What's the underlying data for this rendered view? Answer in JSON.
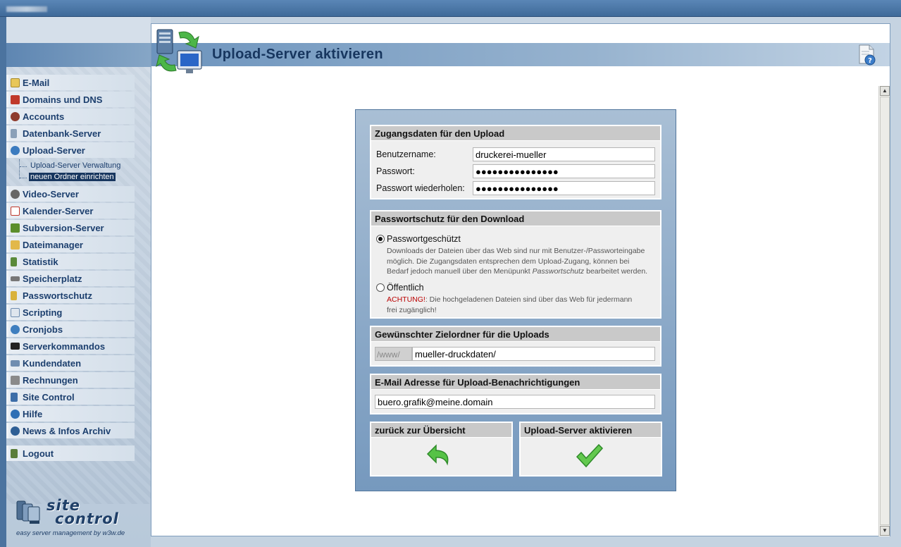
{
  "window": {
    "title": ""
  },
  "sidebar": {
    "items": [
      {
        "label": "E-Mail",
        "icon": "mail-icon",
        "color": "#e8c75a"
      },
      {
        "label": "Domains und DNS",
        "icon": "domains-icon",
        "color": "#c0392b"
      },
      {
        "label": "Accounts",
        "icon": "accounts-icon",
        "color": "#8e3b2d"
      },
      {
        "label": "Datenbank-Server",
        "icon": "database-icon",
        "color": "#8aa0b8"
      },
      {
        "label": "Upload-Server",
        "icon": "upload-server-icon",
        "color": "#3b7bbf"
      }
    ],
    "subitems": [
      {
        "label": "Upload-Server Verwaltung",
        "active": false
      },
      {
        "label": "neuen Ordner einrichten",
        "active": true
      }
    ],
    "items2": [
      {
        "label": "Video-Server",
        "icon": "video-icon",
        "color": "#666"
      },
      {
        "label": "Kalender-Server",
        "icon": "calendar-icon",
        "color": "#c0392b"
      },
      {
        "label": "Subversion-Server",
        "icon": "subversion-icon",
        "color": "#5b8e2c"
      },
      {
        "label": "Dateimanager",
        "icon": "folder-icon",
        "color": "#e2b84a"
      },
      {
        "label": "Statistik",
        "icon": "statistics-icon",
        "color": "#5a8a3a"
      },
      {
        "label": "Speicherplatz",
        "icon": "disk-icon",
        "color": "#777"
      },
      {
        "label": "Passwortschutz",
        "icon": "lock-icon",
        "color": "#d9b23c"
      },
      {
        "label": "Scripting",
        "icon": "script-icon",
        "color": "#6f8db0"
      },
      {
        "label": "Cronjobs",
        "icon": "cronjobs-icon",
        "color": "#3f7fbf"
      },
      {
        "label": "Serverkommandos",
        "icon": "terminal-icon",
        "color": "#222"
      },
      {
        "label": "Kundendaten",
        "icon": "customer-data-icon",
        "color": "#6f8db0"
      },
      {
        "label": "Rechnungen",
        "icon": "invoice-icon",
        "color": "#8a8a8a"
      },
      {
        "label": "Site Control",
        "icon": "site-control-icon",
        "color": "#3d6ea8"
      },
      {
        "label": "Hilfe",
        "icon": "help-icon",
        "color": "#2f6fb5"
      },
      {
        "label": "News & Infos Archiv",
        "icon": "info-icon",
        "color": "#2f5f95"
      }
    ],
    "logout": {
      "label": "Logout",
      "icon": "logout-icon",
      "color": "#5a7d3a"
    },
    "logo": {
      "word1": "site",
      "word2": "control",
      "tagline": "easy server management by w3w.de"
    }
  },
  "header": {
    "title": "Upload-Server aktivieren"
  },
  "form": {
    "access": {
      "heading": "Zugangsdaten für den Upload",
      "username_label": "Benutzername:",
      "username_value": "druckerei-mueller",
      "password_label": "Passwort:",
      "password_value": "●●●●●●●●●●●●●●●",
      "password_repeat_label": "Passwort wiederholen:",
      "password_repeat_value": "●●●●●●●●●●●●●●●"
    },
    "protection": {
      "heading": "Passwortschutz für den Download",
      "option1_label": "Passwortgeschützt",
      "option1_desc_a": "Downloads der Dateien über das Web sind nur mit Benutzer-/Passworteingabe",
      "option1_desc_b": "möglich. Die Zugangsdaten entsprechen dem Upload-Zugang, können bei",
      "option1_desc_c": "Bedarf jedoch manuell über den Menüpunkt",
      "option1_desc_em": "Passwortschutz",
      "option1_desc_d": "bearbeitet werden.",
      "option2_label": "Öffentlich",
      "option2_warn": "ACHTUNG!",
      "option2_desc_a": ": Die hochgeladenen Dateien sind über das Web für jedermann",
      "option2_desc_b": "frei zugänglich!",
      "selected": "option1"
    },
    "target": {
      "heading": "Gewünschter Zielordner für die Uploads",
      "prefix": "/www/",
      "value": "mueller-druckdaten/"
    },
    "email": {
      "heading": "E-Mail Adresse für Upload-Benachrichtigungen",
      "value": "buero.grafik@meine.domain"
    },
    "back_label": "zurück zur Übersicht",
    "submit_label": "Upload-Server aktivieren"
  },
  "colors": {
    "accent": "#17365f",
    "form_background": "#8eabc9",
    "section_header": "#c9c9c9"
  }
}
